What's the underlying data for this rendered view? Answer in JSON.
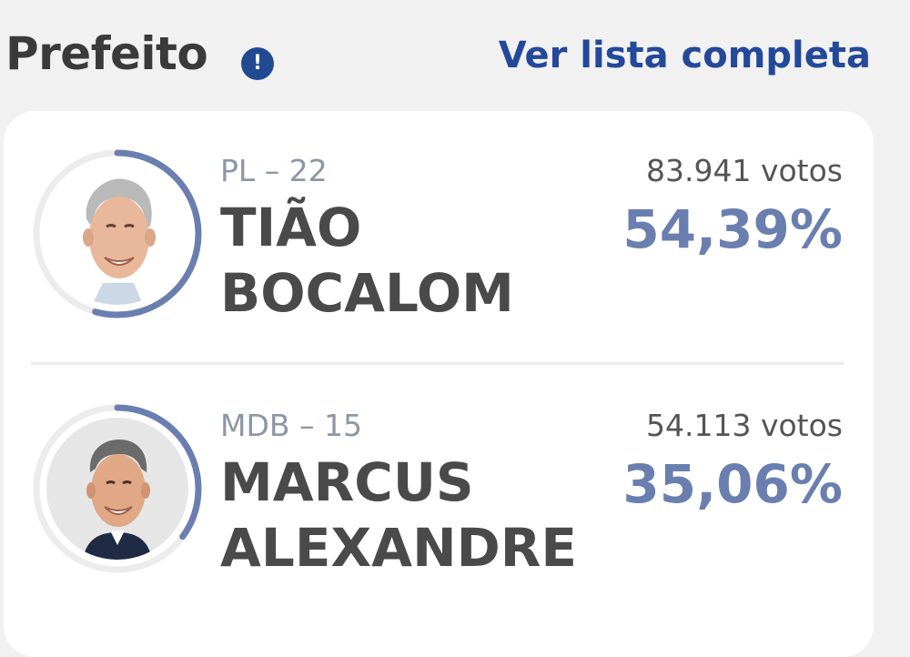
{
  "header": {
    "title": "Prefeito",
    "info_icon": "!",
    "view_list_label": "Ver lista completa"
  },
  "candidates": [
    {
      "party": "PL – 22",
      "name_line1": "TIÃO",
      "name_line2": "BOCALOM",
      "votes": "83.941 votos",
      "percent": "54,39%",
      "percent_value": 54.39
    },
    {
      "party": "MDB – 15",
      "name_line1": "MARCUS",
      "name_line2": "ALEXANDRE",
      "votes": "54.113 votos",
      "percent": "35,06%",
      "percent_value": 35.06
    }
  ],
  "colors": {
    "ring_progress": "#6a7fb0",
    "ring_track": "#ececec",
    "link": "#24489a",
    "info_icon_bg": "#214a93"
  }
}
